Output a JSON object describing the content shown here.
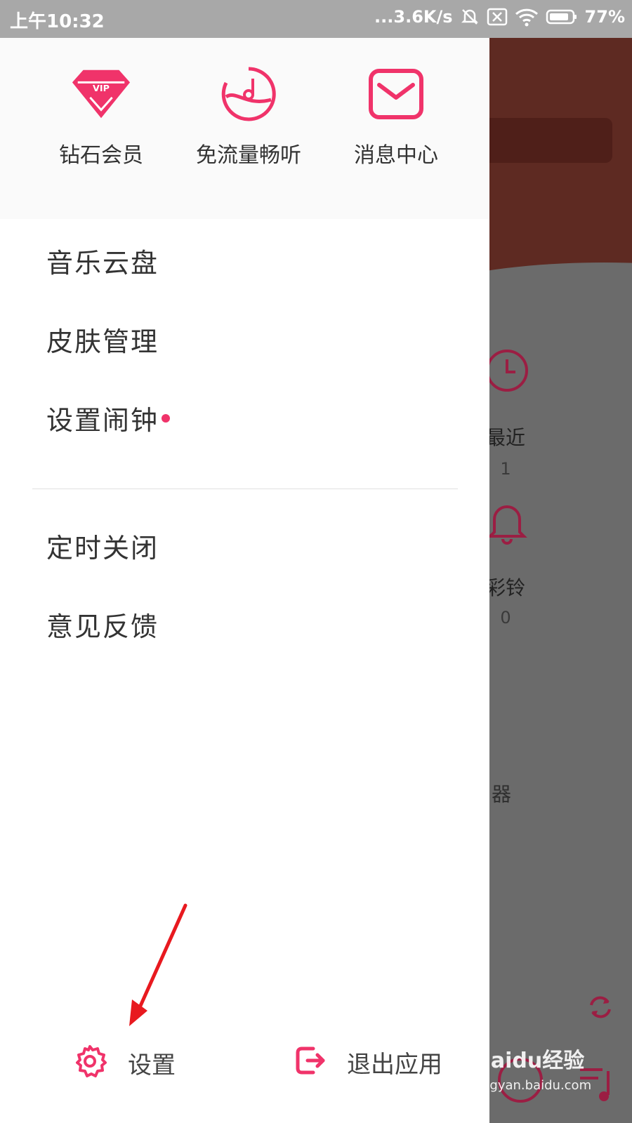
{
  "status_bar": {
    "time": "上午10:32",
    "network_speed": "...3.6K/s",
    "battery": "77%"
  },
  "quick_actions": [
    {
      "label": "钻石会员",
      "icon": "vip-diamond-icon",
      "badge_text": "VIP"
    },
    {
      "label": "免流量畅听",
      "icon": "music-note-circle-icon"
    },
    {
      "label": "消息中心",
      "icon": "envelope-icon"
    }
  ],
  "menu": [
    {
      "label": "音乐云盘"
    },
    {
      "label": "皮肤管理"
    },
    {
      "label": "设置闹钟",
      "has_red_dot": true
    },
    {
      "label": "定时关闭"
    },
    {
      "label": "意见反馈"
    }
  ],
  "bottom": {
    "settings_label": "设置",
    "exit_label": "退出应用"
  },
  "background": {
    "recent_label": "最近",
    "recent_count": "1",
    "ringtone_label": "彩铃",
    "ringtone_count": "0",
    "partial_text": "器"
  },
  "watermark": {
    "brand": "Baidu经验",
    "url": "jingyan.baidu.com"
  },
  "colors": {
    "accent": "#f0336a",
    "statusbar": "#a8a8a8",
    "header_bg": "#5e2a22",
    "overlay": "#6b6b6b"
  }
}
